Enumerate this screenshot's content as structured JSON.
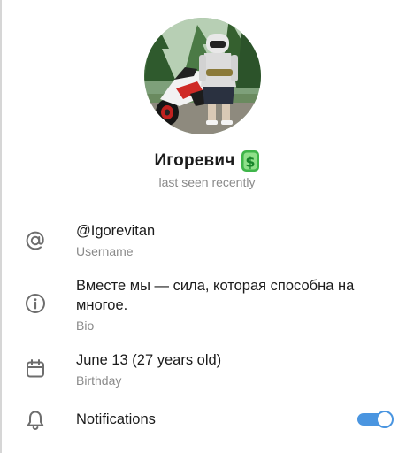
{
  "profile": {
    "name": "Игоревич",
    "status": "last seen recently",
    "emoji_status_icon": "dollar-emoji-icon",
    "avatar_icon": "profile-photo"
  },
  "info": {
    "username": {
      "value": "@Igorevitan",
      "label": "Username",
      "icon": "at-sign-icon"
    },
    "bio": {
      "value": "Вместе мы — сила, которая способна на многое.",
      "label": "Bio",
      "icon": "info-icon"
    },
    "birthday": {
      "value": "June 13 (27 years old)",
      "label": "Birthday",
      "icon": "calendar-icon"
    },
    "notifications": {
      "label": "Notifications",
      "icon": "bell-icon",
      "enabled": true
    }
  },
  "colors": {
    "accent": "#4a95e0",
    "secondary_text": "#8a8a8a",
    "icon": "#6d6d6d"
  }
}
